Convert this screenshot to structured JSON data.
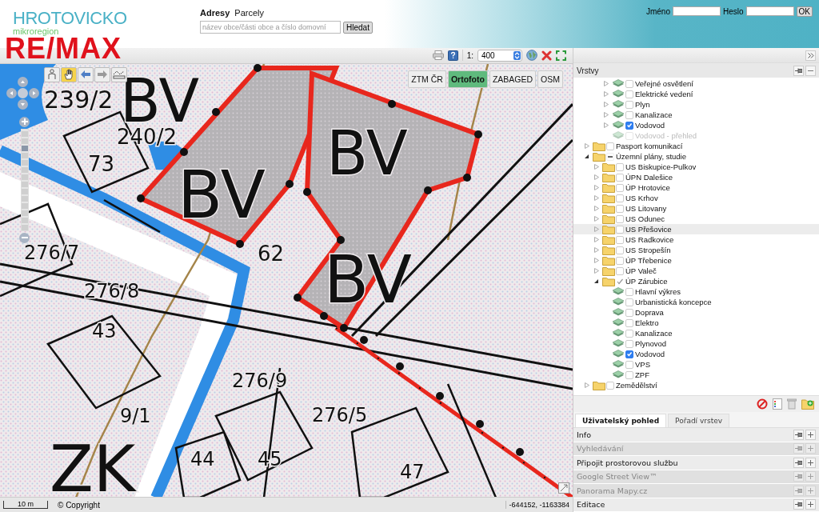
{
  "header": {
    "logo_title": "HROTOVICKO",
    "logo_subtitle": "mikroregion",
    "brand": "RE/MAX",
    "search_tabs": [
      {
        "label": "Adresy",
        "selected": true
      },
      {
        "label": "Parcely",
        "selected": false
      }
    ],
    "search": {
      "placeholder": "název obce/části obce a číslo domovní",
      "button": "Hledat"
    },
    "login": {
      "name_label": "Jméno",
      "password_label": "Heslo",
      "button": "OK"
    }
  },
  "map_toolbar": {
    "scale_prefix": "1:",
    "scale_value": "400"
  },
  "map_tools": [
    {
      "kind": "identify",
      "selected": false
    },
    {
      "kind": "pan",
      "selected": true
    },
    {
      "kind": "back",
      "selected": false
    },
    {
      "kind": "forward",
      "selected": false
    },
    {
      "kind": "measure",
      "selected": false
    }
  ],
  "base_layers": [
    {
      "label": "ZTM ČR",
      "selected": false
    },
    {
      "label": "Ortofoto",
      "selected": true
    },
    {
      "label": "ZABAGED",
      "selected": false
    },
    {
      "label": "OSM",
      "selected": false
    }
  ],
  "map_zoom": {
    "level": 0.85
  },
  "map_labels": [
    "239/2",
    "BV",
    "240/2",
    "73",
    "BV",
    "BV",
    "276/7",
    "62",
    "276/8",
    "BV",
    "43",
    "276/9",
    "276/5",
    "9/1",
    "ZK",
    "44",
    "45",
    "47"
  ],
  "status_bar": {
    "scale": "10 m",
    "copyright": "© Copyright",
    "coordinates": "-644152, -1163384"
  },
  "panel": {
    "layers_title": "Vrstvy",
    "tree": {
      "scrolled_items": [
        {
          "kind": "layer",
          "label": "Veřejné osvětlení",
          "expandable": true,
          "checked": false,
          "disabled": false,
          "selected": false
        },
        {
          "kind": "layer",
          "label": "Elektrické vedení",
          "expandable": true,
          "checked": false,
          "disabled": false,
          "selected": false
        },
        {
          "kind": "layer",
          "label": "Plyn",
          "expandable": true,
          "checked": false,
          "disabled": false,
          "selected": false
        },
        {
          "kind": "layer",
          "label": "Kanalizace",
          "expandable": true,
          "checked": false,
          "disabled": false,
          "selected": false
        },
        {
          "kind": "layer",
          "label": "Vodovod",
          "expandable": true,
          "checked": true,
          "disabled": false,
          "selected": false
        },
        {
          "kind": "layer",
          "label": "Vodovod - přehled",
          "expandable": false,
          "checked": false,
          "disabled": true,
          "selected": false
        }
      ],
      "items": [
        {
          "kind": "folder",
          "label": "Pasport komunikací",
          "expanded": false,
          "checked": false,
          "partial": false,
          "selected": false
        },
        {
          "kind": "folder",
          "label": "Územní plány, studie",
          "expanded": true,
          "checked": false,
          "partial": true,
          "selected": false,
          "children": [
            {
              "kind": "folder",
              "label": "US Biskupice-Pulkov",
              "expanded": false,
              "checked": false,
              "partial": false,
              "selected": false
            },
            {
              "kind": "folder",
              "label": "ÚPN Dalešice",
              "expanded": false,
              "checked": false,
              "partial": false,
              "selected": false
            },
            {
              "kind": "folder",
              "label": "ÚP Hrotovice",
              "expanded": false,
              "checked": false,
              "partial": false,
              "selected": false
            },
            {
              "kind": "folder",
              "label": "US Krhov",
              "expanded": false,
              "checked": false,
              "partial": false,
              "selected": false
            },
            {
              "kind": "folder",
              "label": "US Litovany",
              "expanded": false,
              "checked": false,
              "partial": false,
              "selected": false
            },
            {
              "kind": "folder",
              "label": "US Odunec",
              "expanded": false,
              "checked": false,
              "partial": false,
              "selected": false
            },
            {
              "kind": "folder",
              "label": "US Přešovice",
              "expanded": false,
              "checked": false,
              "partial": false,
              "selected": true
            },
            {
              "kind": "folder",
              "label": "US Radkovice",
              "expanded": false,
              "checked": false,
              "partial": false,
              "selected": false
            },
            {
              "kind": "folder",
              "label": "US Stropešín",
              "expanded": false,
              "checked": false,
              "partial": false,
              "selected": false
            },
            {
              "kind": "folder",
              "label": "ÚP Třebenice",
              "expanded": false,
              "checked": false,
              "partial": false,
              "selected": false
            },
            {
              "kind": "folder",
              "label": "ÚP Valeč",
              "expanded": false,
              "checked": false,
              "partial": false,
              "selected": false
            },
            {
              "kind": "folder",
              "label": "ÚP Zárubice",
              "expanded": true,
              "checked": true,
              "partial": false,
              "selected": false,
              "children": [
                {
                  "kind": "layer",
                  "label": "Hlavní výkres",
                  "expandable": false,
                  "checked": false,
                  "disabled": false,
                  "selected": false
                },
                {
                  "kind": "layer",
                  "label": "Urbanistická koncepce",
                  "expandable": false,
                  "checked": false,
                  "disabled": false,
                  "selected": false
                },
                {
                  "kind": "layer",
                  "label": "Doprava",
                  "expandable": false,
                  "checked": false,
                  "disabled": false,
                  "selected": false
                },
                {
                  "kind": "layer",
                  "label": "Elektro",
                  "expandable": false,
                  "checked": false,
                  "disabled": false,
                  "selected": false
                },
                {
                  "kind": "layer",
                  "label": "Kanalizace",
                  "expandable": false,
                  "checked": false,
                  "disabled": false,
                  "selected": false
                },
                {
                  "kind": "layer",
                  "label": "Plynovod",
                  "expandable": false,
                  "checked": false,
                  "disabled": false,
                  "selected": false
                },
                {
                  "kind": "layer",
                  "label": "Vodovod",
                  "expandable": false,
                  "checked": true,
                  "disabled": false,
                  "selected": false
                },
                {
                  "kind": "layer",
                  "label": "VPS",
                  "expandable": false,
                  "checked": false,
                  "disabled": false,
                  "selected": false
                },
                {
                  "kind": "layer",
                  "label": "ZPF",
                  "expandable": false,
                  "checked": false,
                  "disabled": false,
                  "selected": false
                }
              ]
            }
          ]
        },
        {
          "kind": "folder",
          "label": "Zemědělství",
          "expanded": false,
          "checked": false,
          "partial": false,
          "selected": false
        }
      ]
    },
    "tabs": [
      {
        "label": "Uživatelský pohled",
        "selected": true
      },
      {
        "label": "Pořadí vrstev",
        "selected": false
      }
    ],
    "sections": [
      {
        "label": "Info",
        "disabled": false
      },
      {
        "label": "Vyhledávání",
        "disabled": true
      },
      {
        "label": "Připojit prostorovou službu",
        "disabled": false
      },
      {
        "label": "Google Street View™",
        "disabled": true
      },
      {
        "label": "Panorama Mapy.cz",
        "disabled": true
      },
      {
        "label": "Editace",
        "disabled": false
      }
    ]
  }
}
